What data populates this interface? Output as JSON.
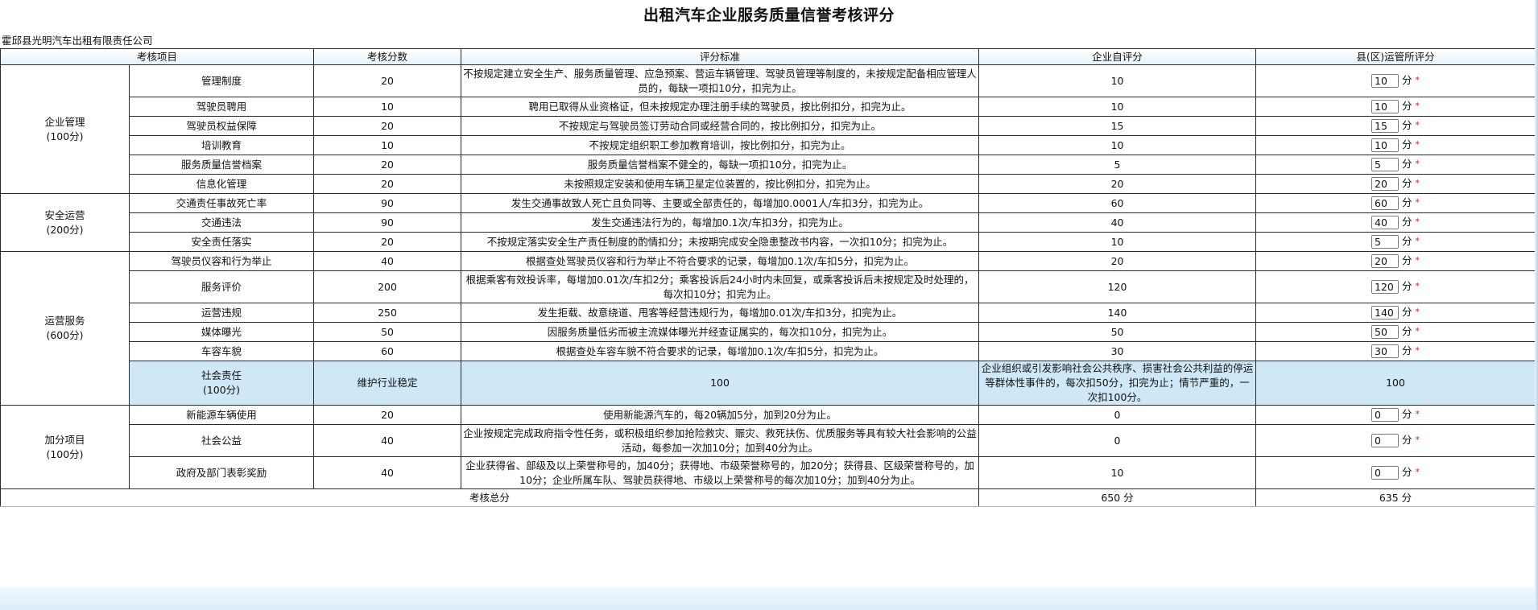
{
  "title": "出租汽车企业服务质量信誉考核评分",
  "company": "霍邱县光明汽车出租有限责任公司",
  "headers": [
    "考核项目",
    "考核分数",
    "评分标准",
    "企业自评分",
    "县(区)运管所评分"
  ],
  "score_unit": "分",
  "required_mark": "*",
  "categories": [
    {
      "name": "企业管理",
      "points": "(100分)"
    },
    {
      "name": "安全运营",
      "points": "(200分)"
    },
    {
      "name": "运营服务",
      "points": "(600分)"
    },
    {
      "name": "社会责任",
      "points": "(100分)"
    },
    {
      "name": "加分项目",
      "points": "(100分)"
    }
  ],
  "rows": [
    {
      "item": "管理制度",
      "score": "20",
      "criteria": "不按规定建立安全生产、服务质量管理、应急预案、营运车辆管理、驾驶员管理等制度的，未按规定配备相应管理人员的，每缺一项扣10分，扣完为止。",
      "self": "10",
      "county": "10"
    },
    {
      "item": "驾驶员聘用",
      "score": "10",
      "criteria": "聘用已取得从业资格证，但未按规定办理注册手续的驾驶员，按比例扣分，扣完为止。",
      "self": "10",
      "county": "10"
    },
    {
      "item": "驾驶员权益保障",
      "score": "20",
      "criteria": "不按规定与驾驶员签订劳动合同或经营合同的，按比例扣分，扣完为止。",
      "self": "15",
      "county": "15"
    },
    {
      "item": "培训教育",
      "score": "10",
      "criteria": "不按规定组织职工参加教育培训，按比例扣分，扣完为止。",
      "self": "10",
      "county": "10"
    },
    {
      "item": "服务质量信誉档案",
      "score": "20",
      "criteria": "服务质量信誉档案不健全的，每缺一项扣10分，扣完为止。",
      "self": "5",
      "county": "5"
    },
    {
      "item": "信息化管理",
      "score": "20",
      "criteria": "未按照规定安装和使用车辆卫星定位装置的，按比例扣分，扣完为止。",
      "self": "20",
      "county": "20"
    },
    {
      "item": "交通责任事故死亡率",
      "score": "90",
      "criteria": "发生交通事故致人死亡且负同等、主要或全部责任的，每增加0.0001人/车扣3分，扣完为止。",
      "self": "60",
      "county": "60"
    },
    {
      "item": "交通违法",
      "score": "90",
      "criteria": "发生交通违法行为的，每增加0.1次/车扣3分，扣完为止。",
      "self": "40",
      "county": "40"
    },
    {
      "item": "安全责任落实",
      "score": "20",
      "criteria": "不按规定落实安全生产责任制度的酌情扣分；未按期完成安全隐患整改书内容，一次扣10分；扣完为止。",
      "self": "10",
      "county": "5"
    },
    {
      "item": "驾驶员仪容和行为举止",
      "score": "40",
      "criteria": "根据查处驾驶员仪容和行为举止不符合要求的记录，每增加0.1次/车扣5分，扣完为止。",
      "self": "20",
      "county": "20"
    },
    {
      "item": "服务评价",
      "score": "200",
      "criteria": "根据乘客有效投诉率，每增加0.01次/车扣2分；乘客投诉后24小时内未回复，或乘客投诉后未按规定及时处理的，每次扣10分；扣完为止。",
      "self": "120",
      "county": "120"
    },
    {
      "item": "运营违规",
      "score": "250",
      "criteria": "发生拒载、故意绕道、甩客等经营违规行为，每增加0.01次/车扣3分，扣完为止。",
      "self": "140",
      "county": "140"
    },
    {
      "item": "媒体曝光",
      "score": "50",
      "criteria": "因服务质量低劣而被主流媒体曝光并经查证属实的，每次扣10分，扣完为止。",
      "self": "50",
      "county": "50"
    },
    {
      "item": "车容车貌",
      "score": "60",
      "criteria": "根据查处车容车貌不符合要求的记录，每增加0.1次/车扣5分，扣完为止。",
      "self": "30",
      "county": "30"
    },
    {
      "item": "维护行业稳定",
      "score": "100",
      "criteria": "企业组织或引发影响社会公共秩序、损害社会公共利益的停运等群体性事件的，每次扣50分，扣完为止；情节严重的，一次扣100分。",
      "self": "100",
      "county": "100"
    },
    {
      "item": "新能源车辆使用",
      "score": "20",
      "criteria": "使用新能源汽车的，每20辆加5分，加到20分为止。",
      "self": "0",
      "county": "0"
    },
    {
      "item": "社会公益",
      "score": "40",
      "criteria": "企业按规定完成政府指令性任务，或积极组织参加抢险救灾、赈灾、救死扶伤、优质服务等具有较大社会影响的公益活动，每参加一次加10分；加到40分为止。",
      "self": "0",
      "county": "0"
    },
    {
      "item": "政府及部门表彰奖励",
      "score": "40",
      "criteria": "企业获得省、部级及以上荣誉称号的，加40分；获得地、市级荣誉称号的，加20分；获得县、区级荣誉称号的，加10分；企业所属车队、驾驶员获得地、市级以上荣誉称号的每次加10分；加到40分为止。",
      "self": "10",
      "county": "0"
    }
  ],
  "total": {
    "label": "考核总分",
    "self": "650 分",
    "county": "635 分"
  }
}
